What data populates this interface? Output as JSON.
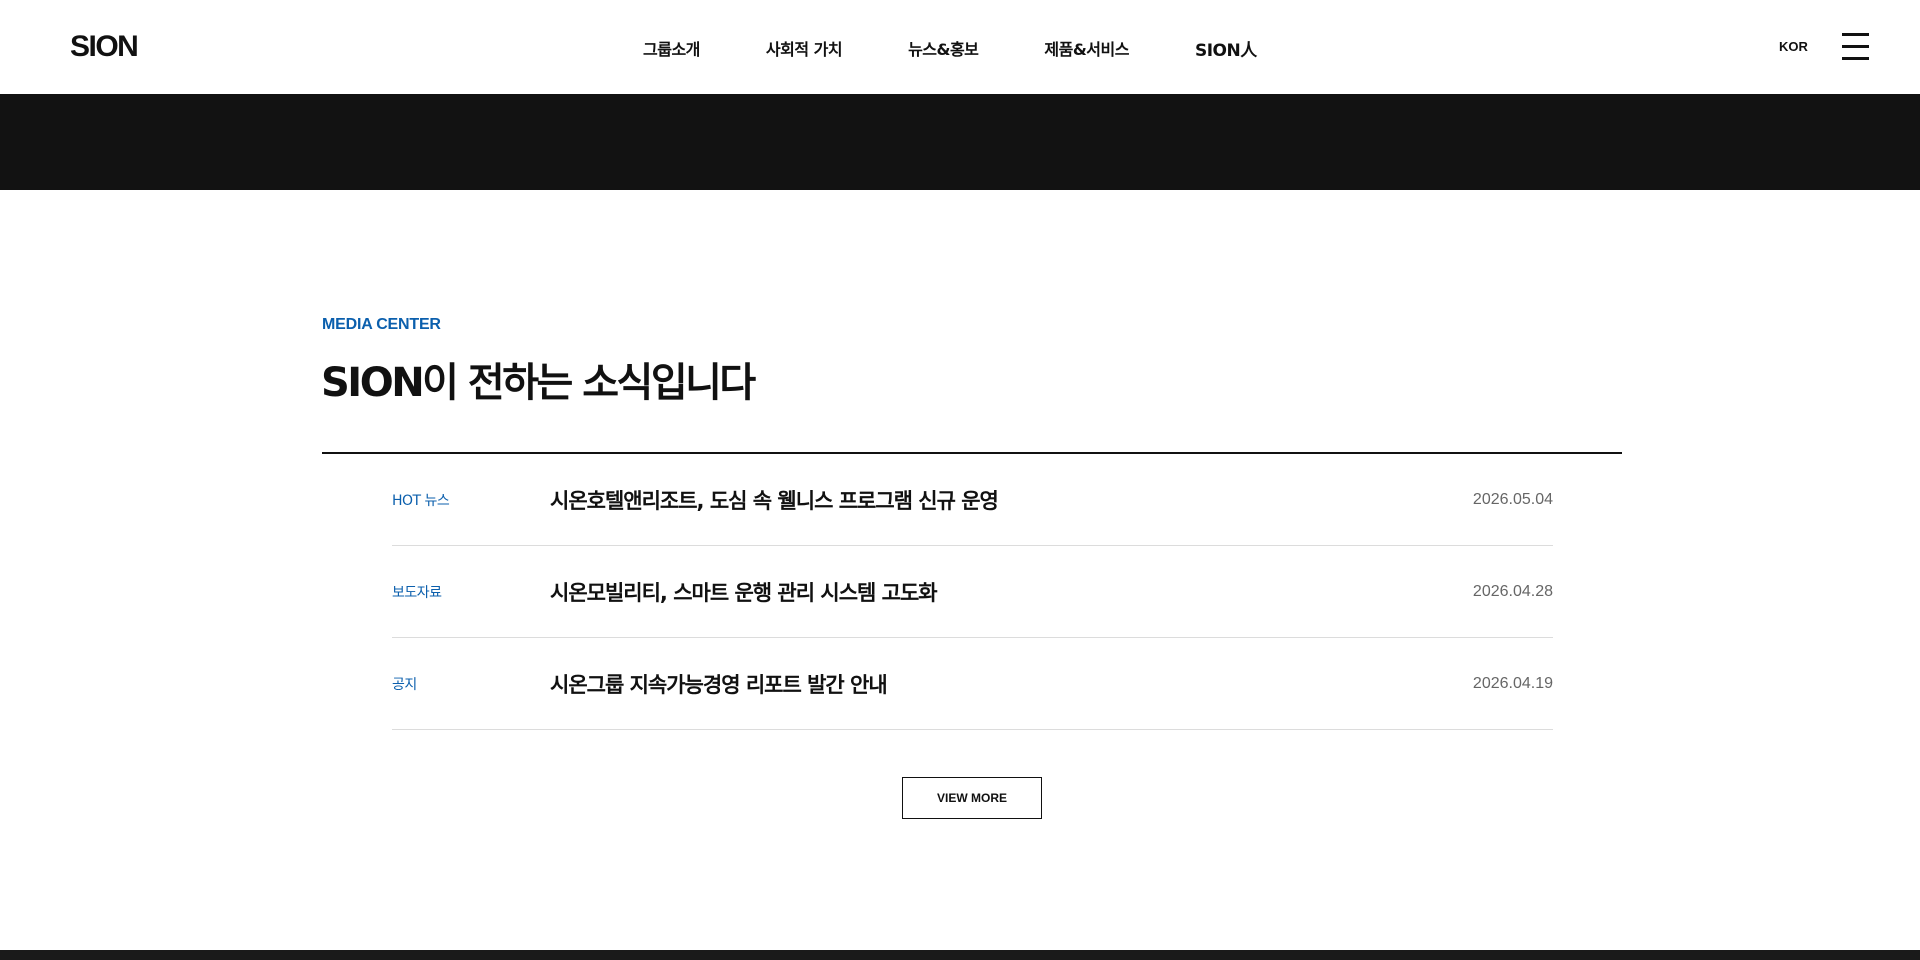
{
  "header": {
    "logo": "SION",
    "nav": [
      "그룹소개",
      "사회적 가치",
      "뉴스&홍보",
      "제품&서비스",
      "SION人"
    ],
    "language": "KOR",
    "menu_icon": "hamburger-menu-icon"
  },
  "section": {
    "eyebrow": "MEDIA CENTER",
    "title": "SION이 전하는 소식입니다",
    "news": [
      {
        "category": "HOT 뉴스",
        "title": "시온호텔앤리조트, 도심 속 웰니스 프로그램 신규 운영",
        "date": "2026.05.04"
      },
      {
        "category": "보도자료",
        "title": "시온모빌리티, 스마트 운행 관리 시스템 고도화",
        "date": "2026.04.28"
      },
      {
        "category": "공지",
        "title": "시온그룹 지속가능경영 리포트 발간 안내",
        "date": "2026.04.19"
      }
    ],
    "view_more": "VIEW MORE"
  },
  "colors": {
    "accent": "#0b5fad",
    "dark_band": "#121212",
    "text": "#111111",
    "date": "#666666"
  }
}
